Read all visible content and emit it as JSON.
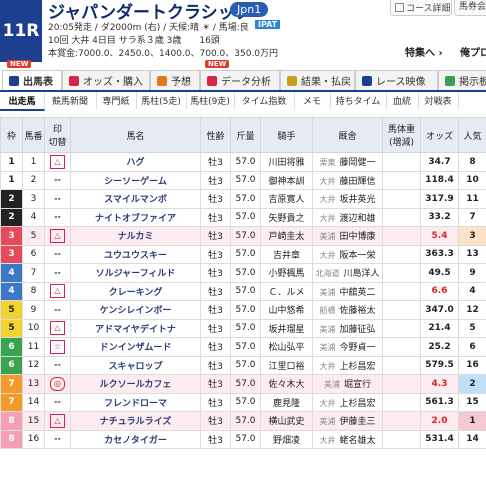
{
  "header": {
    "race_no": "11R",
    "title": "ジャパンダートクラシック",
    "grade": "Jpn1",
    "meta1": "20:05発走 / ダ2000m (右) / 天候:晴 ☀ / 馬場:良",
    "ipat": "IPAT",
    "meta2": "10回 大井 4日目 サラ系３歳 3歳　　16頭",
    "meta3": "本賞金:7000.0、2450.0、1400.0、700.0、350.0万円",
    "course_btn": "コース詳細",
    "horse_btn": "馬券会",
    "special_link": "特集へ ›",
    "odds_link": "俺プロ"
  },
  "main_tabs": [
    {
      "label": "出馬表",
      "new": true,
      "color": "#1c3f8f"
    },
    {
      "label": "オッズ・購入",
      "new": false,
      "color": "#d6244a"
    },
    {
      "label": "予想",
      "new": false,
      "color": "#e07a20"
    },
    {
      "label": "データ分析",
      "new": true,
      "color": "#d6244a"
    },
    {
      "label": "結果・払戻",
      "new": false,
      "color": "#c8a020"
    },
    {
      "label": "レース映像",
      "new": false,
      "color": "#1c3f8f"
    },
    {
      "label": "掲示板",
      "new": false,
      "color": "#3aa050"
    }
  ],
  "new_label": "NEW",
  "sub_tabs": [
    "出走馬",
    "競馬新聞",
    "専門紙",
    "馬柱(5走)",
    "馬柱(9走)",
    "タイム指数",
    "メモ",
    "持ちタイム",
    "血統",
    "対戦表"
  ],
  "columns": {
    "waku": "枠",
    "umaban": "馬番",
    "mark": "印",
    "mark2": "切替",
    "name": "馬名",
    "sex": "性齢",
    "weight": "斤量",
    "jockey": "騎手",
    "trainer": "厩舎",
    "body": "馬体重",
    "body2": "(増減)",
    "odds": "オッズ",
    "pop": "人気"
  },
  "entries": [
    {
      "waku": "1",
      "num": "1",
      "mark": "△",
      "name": "ハグ",
      "sex": "牡3",
      "wt": "57.0",
      "jockey": "川田将雅",
      "loc": "栗東",
      "trainer": "藤岡健一",
      "odds": "34.7",
      "pop": "8"
    },
    {
      "waku": "1",
      "num": "2",
      "mark": "--",
      "name": "シーソーゲーム",
      "sex": "牡3",
      "wt": "57.0",
      "jockey": "御神本訓",
      "loc": "大井",
      "trainer": "藤田輝信",
      "odds": "118.4",
      "pop": "10"
    },
    {
      "waku": "2",
      "num": "3",
      "mark": "--",
      "name": "スマイルマンボ",
      "sex": "牡3",
      "wt": "57.0",
      "jockey": "吉原寛人",
      "loc": "大井",
      "trainer": "坂井英光",
      "odds": "317.9",
      "pop": "11"
    },
    {
      "waku": "2",
      "num": "4",
      "mark": "--",
      "name": "ナイトオブファイア",
      "sex": "牡3",
      "wt": "57.0",
      "jockey": "矢野貴之",
      "loc": "大井",
      "trainer": "渡辺和雄",
      "odds": "33.2",
      "pop": "7"
    },
    {
      "waku": "3",
      "num": "5",
      "mark": "△",
      "name": "ナルカミ",
      "sex": "牡3",
      "wt": "57.0",
      "jockey": "戸崎圭太",
      "loc": "美浦",
      "trainer": "田中博康",
      "odds": "5.4",
      "pop": "3"
    },
    {
      "waku": "3",
      "num": "6",
      "mark": "--",
      "name": "ユウユウスキー",
      "sex": "牡3",
      "wt": "57.0",
      "jockey": "吉井章",
      "loc": "大井",
      "trainer": "阪本一栄",
      "odds": "363.3",
      "pop": "13"
    },
    {
      "waku": "4",
      "num": "7",
      "mark": "--",
      "name": "ソルジャーフィルド",
      "sex": "牡3",
      "wt": "57.0",
      "jockey": "小野楓馬",
      "loc": "北海道",
      "trainer": "川島洋人",
      "odds": "49.5",
      "pop": "9"
    },
    {
      "waku": "4",
      "num": "8",
      "mark": "△",
      "name": "クレーキング",
      "sex": "牡3",
      "wt": "57.0",
      "jockey": "Ｃ．ルメ",
      "loc": "美浦",
      "trainer": "中舘英二",
      "odds": "6.6",
      "pop": "4"
    },
    {
      "waku": "5",
      "num": "9",
      "mark": "--",
      "name": "ケンシレインボー",
      "sex": "牡3",
      "wt": "57.0",
      "jockey": "山中悠希",
      "loc": "船橋",
      "trainer": "佐藤裕太",
      "odds": "347.0",
      "pop": "12"
    },
    {
      "waku": "5",
      "num": "10",
      "mark": "△",
      "name": "アドマイヤデイトナ",
      "sex": "牡3",
      "wt": "57.0",
      "jockey": "坂井瑠星",
      "loc": "美浦",
      "trainer": "加藤征弘",
      "odds": "21.4",
      "pop": "5"
    },
    {
      "waku": "6",
      "num": "11",
      "mark": "☆",
      "name": "ドンインザムード",
      "sex": "牡3",
      "wt": "57.0",
      "jockey": "松山弘平",
      "loc": "美浦",
      "trainer": "今野貞一",
      "odds": "25.2",
      "pop": "6"
    },
    {
      "waku": "6",
      "num": "12",
      "mark": "--",
      "name": "スキャロップ",
      "sex": "牡3",
      "wt": "57.0",
      "jockey": "江里口裕",
      "loc": "大井",
      "trainer": "上杉昌宏",
      "odds": "579.5",
      "pop": "16"
    },
    {
      "waku": "7",
      "num": "13",
      "mark": "◎",
      "name": "ルクソールカフェ",
      "sex": "牡3",
      "wt": "57.0",
      "jockey": "佐々木大",
      "loc": "美浦",
      "trainer": "堀宣行",
      "odds": "4.3",
      "pop": "2"
    },
    {
      "waku": "7",
      "num": "14",
      "mark": "--",
      "name": "フレンドローマ",
      "sex": "牡3",
      "wt": "57.0",
      "jockey": "鹿見隆",
      "loc": "大井",
      "trainer": "上杉昌宏",
      "odds": "561.3",
      "pop": "15"
    },
    {
      "waku": "8",
      "num": "15",
      "mark": "△",
      "name": "ナチュラルライズ",
      "sex": "牡3",
      "wt": "57.0",
      "jockey": "横山武史",
      "loc": "美浦",
      "trainer": "伊藤圭三",
      "odds": "2.0",
      "pop": "1"
    },
    {
      "waku": "8",
      "num": "16",
      "mark": "--",
      "name": "カセノタイガー",
      "sex": "牡3",
      "wt": "57.0",
      "jockey": "野畑凌",
      "loc": "大井",
      "trainer": "蛯名雄太",
      "odds": "531.4",
      "pop": "14"
    }
  ],
  "waku_colors": {
    "1": {
      "bg": "#ffffff",
      "fg": "#222222"
    },
    "2": {
      "bg": "#222222",
      "fg": "#ffffff"
    },
    "3": {
      "bg": "#e8495a",
      "fg": "#ffffff"
    },
    "4": {
      "bg": "#3b78c8",
      "fg": "#ffffff"
    },
    "5": {
      "bg": "#f2d230",
      "fg": "#222222"
    },
    "6": {
      "bg": "#3aa350",
      "fg": "#ffffff"
    },
    "7": {
      "bg": "#f39a2a",
      "fg": "#ffffff"
    },
    "8": {
      "bg": "#f4a0b4",
      "fg": "#ffffff"
    }
  }
}
